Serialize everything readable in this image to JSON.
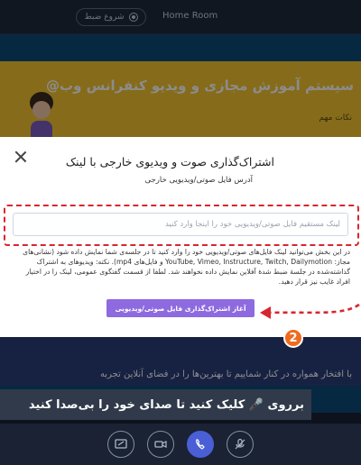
{
  "header": {
    "room_name": "Home Room",
    "record_label": "شروع ضبط"
  },
  "slide": {
    "title": "سیستم آموزش مجازی و ویدیو کنفرانس وب@",
    "subtitle": "نکات مهم",
    "caption": "با افتخار همواره در کنار شماییم تا بهترین‌ها را در فضای آنلاین تجربه"
  },
  "hint": {
    "text": "برروی 🎤 کلیک کنید تا صدای خود را بی‌صدا کنید"
  },
  "modal": {
    "title": "اشتراک‌گذاری صوت و ویدیوی خارجی با لینک",
    "field_label": "آدرس فایل صوتی/ویدیویی خارجی",
    "input_value": "",
    "input_placeholder": "لینک مستقیم فایل صوتی/ویدیویی خود را اینجا وارد کنید",
    "description": "در این بخش می‌توانید لینک فایل‌های صوتی/ویدیویی خود را وارد کنید تا در جلسه‌ی شما نمایش داده شود (نشانی‌های مجاز: YouTube, Vimeo, Instructure, Twitch, Dailymotion و فایل‌های mp4). نکته: ویدیوهای به اشتراک گذاشته‌شده در جلسهٔ ضبط شدهٔ آفلاین نمایش داده نخواهند شد. لطفا از قسمت گفتگوی عمومی، لینک را در اختیار افراد غایب نیز قرار دهید.",
    "submit_label": "آغاز اشتراک‌گذاری فایل صوتی/ویدیویی"
  },
  "annotation": {
    "step": "2",
    "color": "#d8262e"
  },
  "toolbar": {
    "buttons": [
      "screen-share-icon",
      "camera-icon",
      "phone-icon",
      "mic-muted-icon"
    ]
  }
}
